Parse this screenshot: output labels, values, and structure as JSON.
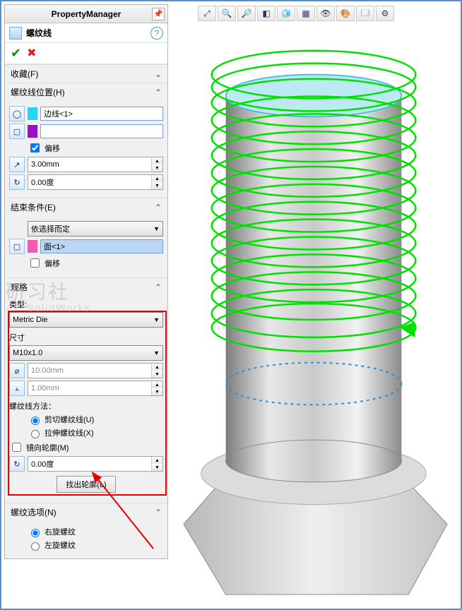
{
  "pm_title": "PropertyManager",
  "feature_name": "螺纹线",
  "sections": {
    "fav": "收藏(F)",
    "pos": "螺纹线位置(H)",
    "end": "结束条件(E)",
    "spec": "规格",
    "opts": "螺纹选项(N)"
  },
  "pos": {
    "edge": "边线<1>",
    "offset_label": "偏移",
    "offset_checked": true,
    "dist": "3.00mm",
    "angle": "0.00度"
  },
  "end": {
    "combo": "依选择而定",
    "face": "面<1>",
    "offset_label": "偏移",
    "offset_checked": false
  },
  "spec": {
    "type_label": "类型:",
    "type_val": "Metric Die",
    "size_label": "尺寸",
    "size_val": "M10x1.0",
    "diam": "10.00mm",
    "pitch": "1.00mm",
    "method_label": "螺纹线方法：",
    "cut_label": "剪切螺纹线(U)",
    "extrude_label": "拉伸螺纹线(X)",
    "mirror_label": "镜向轮廓(M)",
    "angle2": "0.00度",
    "find_profile": "找出轮廓(L)"
  },
  "opts": {
    "right_label": "右旋螺纹",
    "left_label": "左旋螺纹"
  },
  "watermark": "研习社",
  "watermark_sub": "SolidWorks"
}
